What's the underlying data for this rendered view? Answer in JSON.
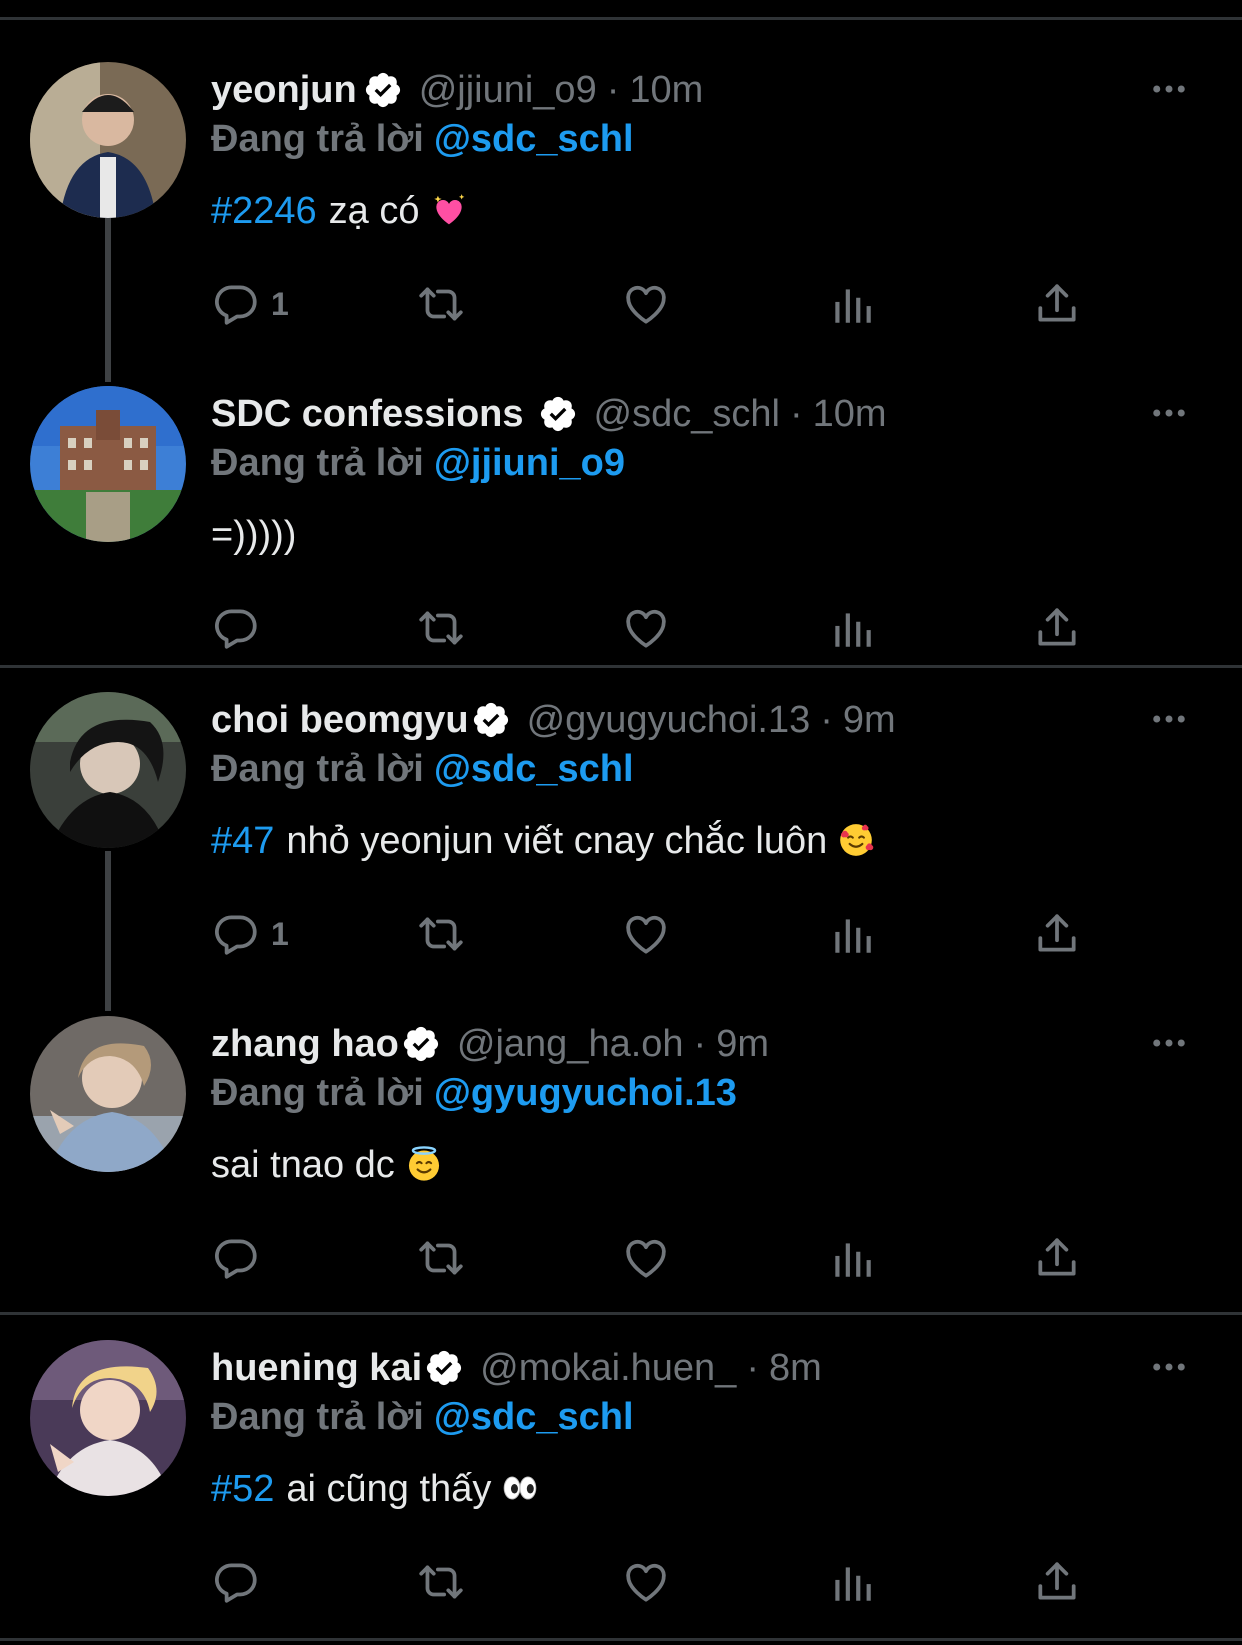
{
  "reply_prefix": "Đang trả lời",
  "tweets": [
    {
      "name": "yeonjun",
      "handle": "@jjiuni_o9",
      "time": "10m",
      "reply_to": "@sdc_schl",
      "hashtag": "#2246",
      "text": "zạ có",
      "emoji_icon": "sparkling-heart-icon",
      "reply_count": "1"
    },
    {
      "name": "SDC confessions",
      "handle": "@sdc_schl",
      "time": "10m",
      "reply_to": "@jjiuni_o9",
      "hashtag": "",
      "text": "=)))))",
      "emoji_icon": "",
      "reply_count": ""
    },
    {
      "name": "choi beomgyu",
      "handle": "@gyugyuchoi.13",
      "time": "9m",
      "reply_to": "@sdc_schl",
      "hashtag": "#47",
      "text": "nhỏ yeonjun viết cnay chắc luôn",
      "emoji_icon": "smiling-face-with-hearts-icon",
      "reply_count": "1"
    },
    {
      "name": "zhang hao",
      "handle": "@jang_ha.oh",
      "time": "9m",
      "reply_to": "@gyugyuchoi.13",
      "hashtag": "",
      "text": "sai tnao dc",
      "emoji_icon": "smiling-face-with-halo-icon",
      "reply_count": ""
    },
    {
      "name": "huening kai",
      "handle": "@mokai.huen_",
      "time": "8m",
      "reply_to": "@sdc_schl",
      "hashtag": "#52",
      "text": "ai cũng thấy",
      "emoji_icon": "eyes-icon",
      "reply_count": ""
    }
  ],
  "colors": {
    "background": "#000000",
    "text": "#e7e9ea",
    "muted": "#71767b",
    "link": "#1d9bf0",
    "divider": "#2f3336"
  }
}
